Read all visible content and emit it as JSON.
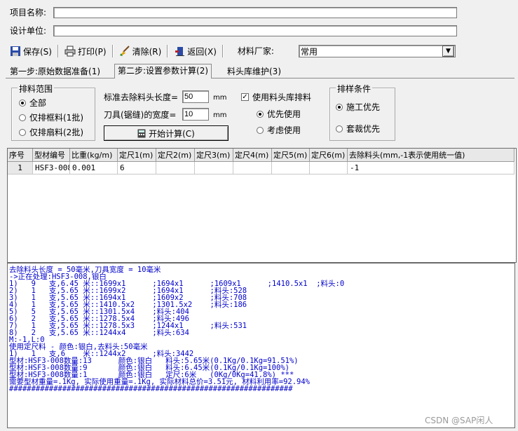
{
  "form": {
    "project_label": "项目名称:",
    "project_value": "",
    "design_label": "设计单位:",
    "design_value": ""
  },
  "toolbar": {
    "save": "保存(S)",
    "print": "打印(P)",
    "clear": "清除(R)",
    "back": "返回(X)",
    "maker_label": "材料厂家:",
    "maker_value": "常用"
  },
  "tabs": [
    "第一步:原始数据准备(1)",
    "第二步:设置参数计算(2)",
    "料头库维护(3)"
  ],
  "range_group": {
    "title": "排料范围",
    "options": [
      "全部",
      "仅排框料(1批)",
      "仅排扇料(2批)"
    ],
    "selected": 0
  },
  "params": {
    "cut_label": "标准去除料头长度=",
    "cut_value": "50",
    "cut_unit": "mm",
    "blade_label": "刀具(锯缝)的宽度=",
    "blade_value": "10",
    "blade_unit": "mm",
    "start_button": "开始计算(C)"
  },
  "library": {
    "use_label": "使用料头库排料",
    "use_checked": true,
    "options": [
      "优先使用",
      "考虑使用"
    ],
    "selected": 0
  },
  "condition_group": {
    "title": "排样条件",
    "options": [
      "施工优先",
      "套裁优先"
    ],
    "selected": 0
  },
  "grid": {
    "headers": [
      "序号",
      "型材编号",
      "比重(kg/m)",
      "定尺1(m)",
      "定尺2(m)",
      "定尺3(m)",
      "定尺4(m)",
      "定尺5(m)",
      "定尺6(m)",
      "去除料头(mm,-1表示使用统一值)"
    ],
    "rows": [
      [
        "1",
        "HSF3-008",
        "0.001",
        "6",
        "",
        "",
        "",
        "",
        "",
        "-1"
      ]
    ]
  },
  "log": [
    "去除料头长度 = 50毫米,刀具宽度 = 10毫米",
    "->正在处理:HSF3-008,银白",
    "1)   9   支,6.45 米::1699x1      ;1694x1      ;1609x1      ;1410.5x1  ;料头:0",
    "2)   1   支,5.65 米::1699x2      ;1694x1      ;料头:528",
    "3)   1   支,5.65 米::1694x1      ;1609x2      ;料头:708",
    "4)   1   支,5.65 米::1410.5x2    ;1301.5x2    ;料头:186",
    "5)   5   支,5.65 米::1301.5x4    ;料头:404",
    "6)   2   支,5.65 米::1278.5x4    ;料头:496",
    "7)   1   支,5.65 米::1278.5x3    ;1244x1      ;料头:531",
    "8)   2   支,5.65 米::1244x4      ;料头:634",
    "M:-1,L:0",
    "使用定尺料 - 颜色:银白,去料头:50毫米",
    "1)   1   支,6    米::1244x2      ;料头:3442",
    "型材:HSF3-008数量:13      颜色:银白   料头:5.65米(0.1Kg/0.1Kg=91.51%)",
    "型材:HSF3-008数量:9       颜色:银白   料头:6.45米(0.1Kg/0.1Kg=100%)",
    "型材:HSF3-008数量:1       颜色:银白   定尺:6米   (0Kg/0Kg=41.8%) ***",
    "需要型材重量=.1Kg, 实际使用重量=.1Kg, 实际材料总价=3.51元, 材料利用率=92.94%",
    "################################################################"
  ],
  "watermark": "CSDN @SAP闲人"
}
